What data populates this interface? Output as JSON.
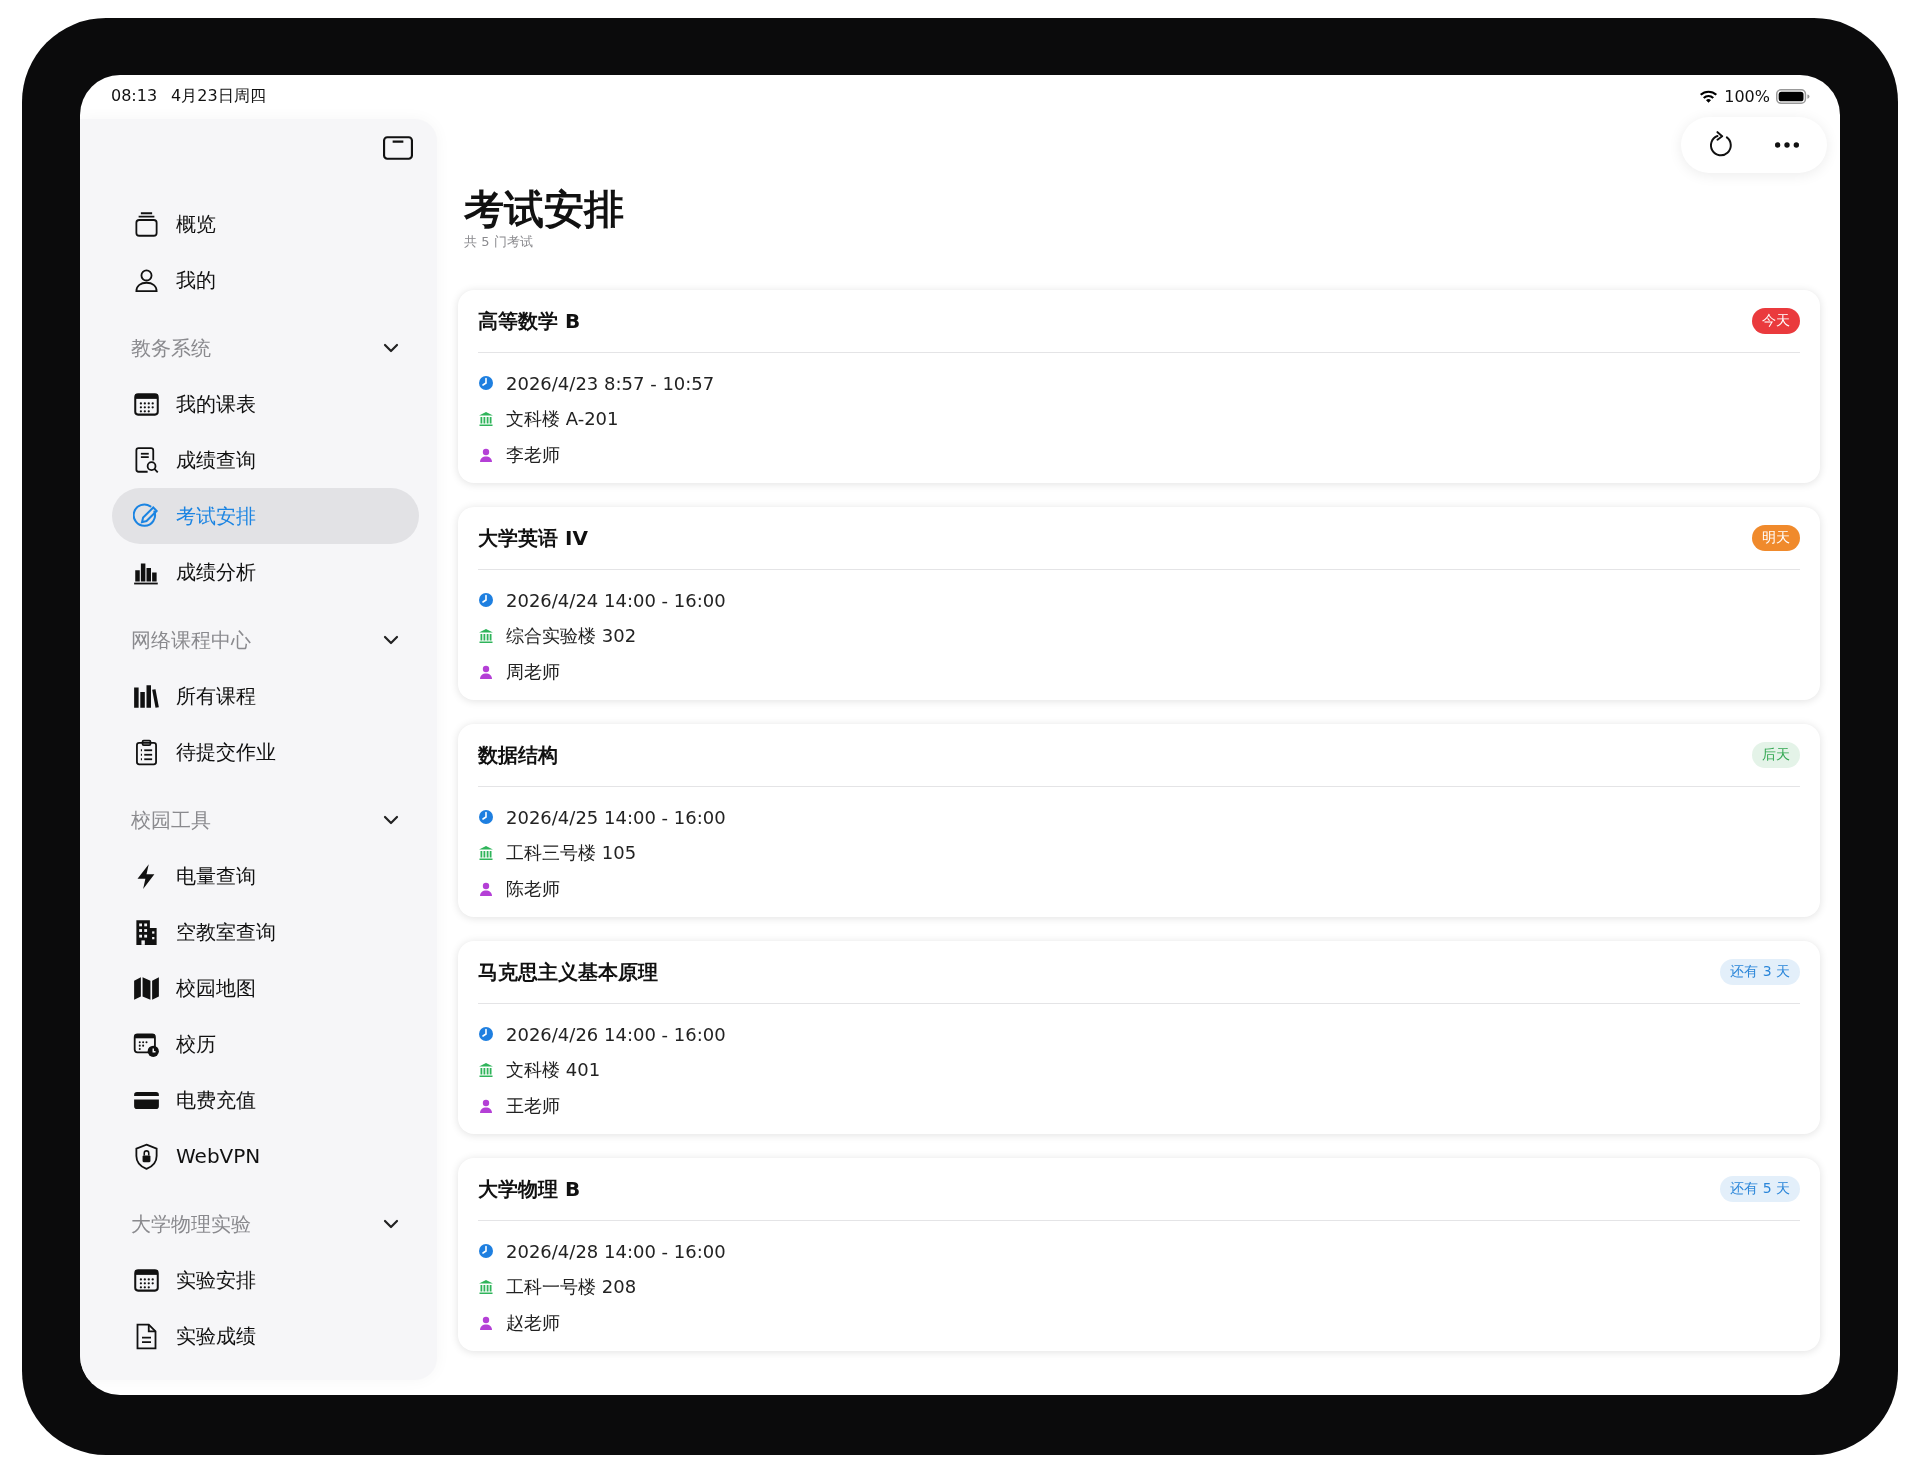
{
  "status_bar": {
    "time": "08:13",
    "date": "4月23日周四",
    "battery": "100%"
  },
  "sidebar": {
    "groups": [
      {
        "items": [
          {
            "label": "概览",
            "selected": false
          },
          {
            "label": "我的",
            "selected": false
          }
        ]
      },
      {
        "title": "教务系统",
        "expanded": true,
        "items": [
          {
            "label": "我的课表",
            "selected": false
          },
          {
            "label": "成绩查询",
            "selected": false
          },
          {
            "label": "考试安排",
            "selected": true
          },
          {
            "label": "成绩分析",
            "selected": false
          }
        ]
      },
      {
        "title": "网络课程中心",
        "expanded": true,
        "items": [
          {
            "label": "所有课程",
            "selected": false
          },
          {
            "label": "待提交作业",
            "selected": false
          }
        ]
      },
      {
        "title": "校园工具",
        "expanded": true,
        "items": [
          {
            "label": "电量查询",
            "selected": false
          },
          {
            "label": "空教室查询",
            "selected": false
          },
          {
            "label": "校园地图",
            "selected": false
          },
          {
            "label": "校历",
            "selected": false
          },
          {
            "label": "电费充值",
            "selected": false
          },
          {
            "label": "WebVPN",
            "selected": false
          }
        ]
      },
      {
        "title": "大学物理实验",
        "expanded": true,
        "items": [
          {
            "label": "实验安排",
            "selected": false
          },
          {
            "label": "实验成绩",
            "selected": false
          }
        ]
      }
    ]
  },
  "page": {
    "title": "考试安排",
    "subtitle": "共 5 门考试"
  },
  "exams": [
    {
      "name": "高等数学 B",
      "badge": {
        "text": "今天",
        "kind": "solid",
        "color": "#ea3a3d"
      },
      "time": "2026/4/23 8:57 - 10:57",
      "place": "文科楼 A-201",
      "teacher": "李老师"
    },
    {
      "name": "大学英语 IV",
      "badge": {
        "text": "明天",
        "kind": "solid",
        "color": "#f08a2c"
      },
      "time": "2026/4/24 14:00 - 16:00",
      "place": "综合实验楼 302",
      "teacher": "周老师"
    },
    {
      "name": "数据结构",
      "badge": {
        "text": "后天",
        "kind": "tint",
        "color": "#34a853"
      },
      "time": "2026/4/25 14:00 - 16:00",
      "place": "工科三号楼 105",
      "teacher": "陈老师"
    },
    {
      "name": "马克思主义基本原理",
      "badge": {
        "text": "还有 3 天",
        "kind": "tint",
        "color": "#2b86d9"
      },
      "time": "2026/4/26 14:00 - 16:00",
      "place": "文科楼 401",
      "teacher": "王老师"
    },
    {
      "name": "大学物理 B",
      "badge": {
        "text": "还有 5 天",
        "kind": "tint",
        "color": "#2b86d9"
      },
      "time": "2026/4/28 14:00 - 16:00",
      "place": "工科一号楼 208",
      "teacher": "赵老师"
    }
  ]
}
